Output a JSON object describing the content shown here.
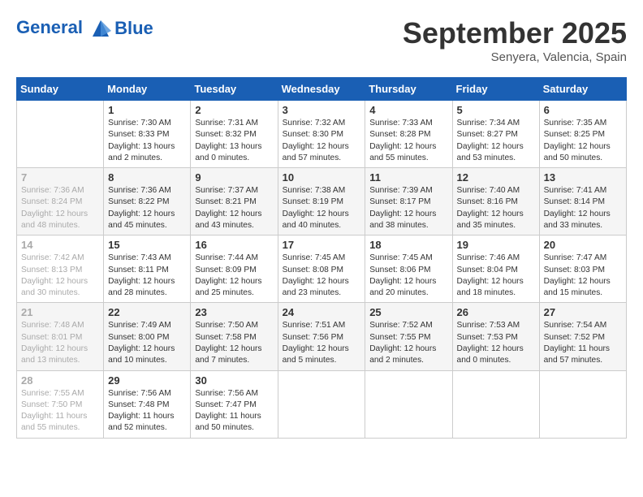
{
  "header": {
    "logo_line1": "General",
    "logo_line2": "Blue",
    "month": "September 2025",
    "location": "Senyera, Valencia, Spain"
  },
  "weekdays": [
    "Sunday",
    "Monday",
    "Tuesday",
    "Wednesday",
    "Thursday",
    "Friday",
    "Saturday"
  ],
  "weeks": [
    [
      {
        "day": "",
        "sunrise": "",
        "sunset": "",
        "daylight": ""
      },
      {
        "day": "1",
        "sunrise": "Sunrise: 7:30 AM",
        "sunset": "Sunset: 8:33 PM",
        "daylight": "Daylight: 13 hours and 2 minutes."
      },
      {
        "day": "2",
        "sunrise": "Sunrise: 7:31 AM",
        "sunset": "Sunset: 8:32 PM",
        "daylight": "Daylight: 13 hours and 0 minutes."
      },
      {
        "day": "3",
        "sunrise": "Sunrise: 7:32 AM",
        "sunset": "Sunset: 8:30 PM",
        "daylight": "Daylight: 12 hours and 57 minutes."
      },
      {
        "day": "4",
        "sunrise": "Sunrise: 7:33 AM",
        "sunset": "Sunset: 8:28 PM",
        "daylight": "Daylight: 12 hours and 55 minutes."
      },
      {
        "day": "5",
        "sunrise": "Sunrise: 7:34 AM",
        "sunset": "Sunset: 8:27 PM",
        "daylight": "Daylight: 12 hours and 53 minutes."
      },
      {
        "day": "6",
        "sunrise": "Sunrise: 7:35 AM",
        "sunset": "Sunset: 8:25 PM",
        "daylight": "Daylight: 12 hours and 50 minutes."
      }
    ],
    [
      {
        "day": "7",
        "sunrise": "Sunrise: 7:36 AM",
        "sunset": "Sunset: 8:24 PM",
        "daylight": "Daylight: 12 hours and 48 minutes."
      },
      {
        "day": "8",
        "sunrise": "Sunrise: 7:36 AM",
        "sunset": "Sunset: 8:22 PM",
        "daylight": "Daylight: 12 hours and 45 minutes."
      },
      {
        "day": "9",
        "sunrise": "Sunrise: 7:37 AM",
        "sunset": "Sunset: 8:21 PM",
        "daylight": "Daylight: 12 hours and 43 minutes."
      },
      {
        "day": "10",
        "sunrise": "Sunrise: 7:38 AM",
        "sunset": "Sunset: 8:19 PM",
        "daylight": "Daylight: 12 hours and 40 minutes."
      },
      {
        "day": "11",
        "sunrise": "Sunrise: 7:39 AM",
        "sunset": "Sunset: 8:17 PM",
        "daylight": "Daylight: 12 hours and 38 minutes."
      },
      {
        "day": "12",
        "sunrise": "Sunrise: 7:40 AM",
        "sunset": "Sunset: 8:16 PM",
        "daylight": "Daylight: 12 hours and 35 minutes."
      },
      {
        "day": "13",
        "sunrise": "Sunrise: 7:41 AM",
        "sunset": "Sunset: 8:14 PM",
        "daylight": "Daylight: 12 hours and 33 minutes."
      }
    ],
    [
      {
        "day": "14",
        "sunrise": "Sunrise: 7:42 AM",
        "sunset": "Sunset: 8:13 PM",
        "daylight": "Daylight: 12 hours and 30 minutes."
      },
      {
        "day": "15",
        "sunrise": "Sunrise: 7:43 AM",
        "sunset": "Sunset: 8:11 PM",
        "daylight": "Daylight: 12 hours and 28 minutes."
      },
      {
        "day": "16",
        "sunrise": "Sunrise: 7:44 AM",
        "sunset": "Sunset: 8:09 PM",
        "daylight": "Daylight: 12 hours and 25 minutes."
      },
      {
        "day": "17",
        "sunrise": "Sunrise: 7:45 AM",
        "sunset": "Sunset: 8:08 PM",
        "daylight": "Daylight: 12 hours and 23 minutes."
      },
      {
        "day": "18",
        "sunrise": "Sunrise: 7:45 AM",
        "sunset": "Sunset: 8:06 PM",
        "daylight": "Daylight: 12 hours and 20 minutes."
      },
      {
        "day": "19",
        "sunrise": "Sunrise: 7:46 AM",
        "sunset": "Sunset: 8:04 PM",
        "daylight": "Daylight: 12 hours and 18 minutes."
      },
      {
        "day": "20",
        "sunrise": "Sunrise: 7:47 AM",
        "sunset": "Sunset: 8:03 PM",
        "daylight": "Daylight: 12 hours and 15 minutes."
      }
    ],
    [
      {
        "day": "21",
        "sunrise": "Sunrise: 7:48 AM",
        "sunset": "Sunset: 8:01 PM",
        "daylight": "Daylight: 12 hours and 13 minutes."
      },
      {
        "day": "22",
        "sunrise": "Sunrise: 7:49 AM",
        "sunset": "Sunset: 8:00 PM",
        "daylight": "Daylight: 12 hours and 10 minutes."
      },
      {
        "day": "23",
        "sunrise": "Sunrise: 7:50 AM",
        "sunset": "Sunset: 7:58 PM",
        "daylight": "Daylight: 12 hours and 7 minutes."
      },
      {
        "day": "24",
        "sunrise": "Sunrise: 7:51 AM",
        "sunset": "Sunset: 7:56 PM",
        "daylight": "Daylight: 12 hours and 5 minutes."
      },
      {
        "day": "25",
        "sunrise": "Sunrise: 7:52 AM",
        "sunset": "Sunset: 7:55 PM",
        "daylight": "Daylight: 12 hours and 2 minutes."
      },
      {
        "day": "26",
        "sunrise": "Sunrise: 7:53 AM",
        "sunset": "Sunset: 7:53 PM",
        "daylight": "Daylight: 12 hours and 0 minutes."
      },
      {
        "day": "27",
        "sunrise": "Sunrise: 7:54 AM",
        "sunset": "Sunset: 7:52 PM",
        "daylight": "Daylight: 11 hours and 57 minutes."
      }
    ],
    [
      {
        "day": "28",
        "sunrise": "Sunrise: 7:55 AM",
        "sunset": "Sunset: 7:50 PM",
        "daylight": "Daylight: 11 hours and 55 minutes."
      },
      {
        "day": "29",
        "sunrise": "Sunrise: 7:56 AM",
        "sunset": "Sunset: 7:48 PM",
        "daylight": "Daylight: 11 hours and 52 minutes."
      },
      {
        "day": "30",
        "sunrise": "Sunrise: 7:56 AM",
        "sunset": "Sunset: 7:47 PM",
        "daylight": "Daylight: 11 hours and 50 minutes."
      },
      {
        "day": "",
        "sunrise": "",
        "sunset": "",
        "daylight": ""
      },
      {
        "day": "",
        "sunrise": "",
        "sunset": "",
        "daylight": ""
      },
      {
        "day": "",
        "sunrise": "",
        "sunset": "",
        "daylight": ""
      },
      {
        "day": "",
        "sunrise": "",
        "sunset": "",
        "daylight": ""
      }
    ]
  ]
}
